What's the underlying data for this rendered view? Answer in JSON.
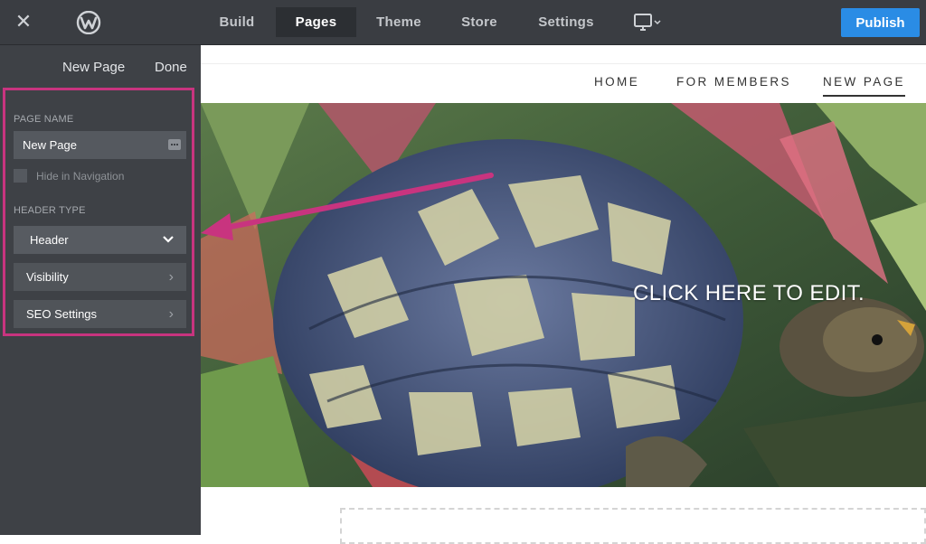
{
  "topbar": {
    "tabs": [
      {
        "label": "Build"
      },
      {
        "label": "Pages"
      },
      {
        "label": "Theme"
      },
      {
        "label": "Store"
      },
      {
        "label": "Settings"
      }
    ],
    "active_tab": "Pages",
    "publish_label": "Publish",
    "icons": {
      "close": "close-icon",
      "logo": "weebly-logo",
      "device": "desktop-icon"
    },
    "accent_color": "#2a8ce5"
  },
  "sidebar": {
    "page_title": "New Page",
    "done_label": "Done",
    "highlight_color": "#c8347f",
    "page_name_label": "PAGE NAME",
    "page_name_value": "New Page",
    "hide_nav_label": "Hide in Navigation",
    "hide_nav_checked": false,
    "header_type_label": "HEADER TYPE",
    "header_type_value": "Header",
    "rows": [
      {
        "label": "Visibility"
      },
      {
        "label": "SEO Settings"
      }
    ]
  },
  "preview": {
    "nav": [
      {
        "label": "HOME"
      },
      {
        "label": "FOR MEMBERS"
      },
      {
        "label": "NEW PAGE"
      }
    ],
    "active_nav": "NEW PAGE",
    "hero_caption": "CLICK HERE TO EDIT."
  }
}
